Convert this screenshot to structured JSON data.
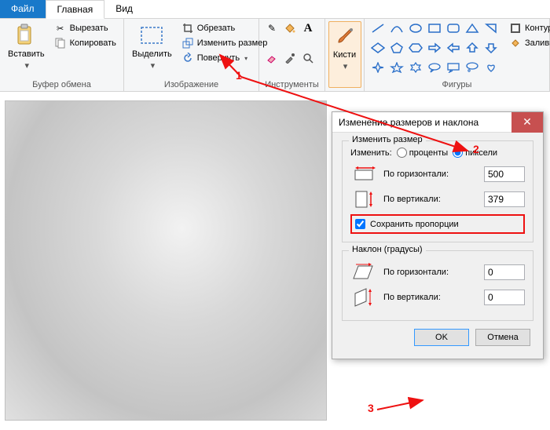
{
  "tabs": {
    "file": "Файл",
    "home": "Главная",
    "view": "Вид"
  },
  "clipboard": {
    "paste": "Вставить",
    "cut": "Вырезать",
    "copy": "Копировать",
    "group": "Буфер обмена"
  },
  "image": {
    "select": "Выделить",
    "crop": "Обрезать",
    "resize": "Изменить размер",
    "rotate": "Повернуть",
    "group": "Изображение"
  },
  "tools": {
    "group": "Инструменты"
  },
  "brushes": {
    "label": "Кисти"
  },
  "shapes": {
    "group": "Фигуры",
    "outline": "Контур",
    "fill": "Заливка"
  },
  "dialog": {
    "title": "Изменение размеров и наклона",
    "resize_legend": "Изменить размер",
    "change_by": "Изменить:",
    "percent": "проценты",
    "pixels": "пиксели",
    "horizontal": "По горизонтали:",
    "vertical": "По вертикали:",
    "h_value": "500",
    "v_value": "379",
    "keep_ratio": "Сохранить пропорции",
    "skew_legend": "Наклон (градусы)",
    "skew_h": "0",
    "skew_v": "0",
    "ok": "OK",
    "cancel": "Отмена"
  },
  "annotations": {
    "a1": "1",
    "a2": "2",
    "a3": "3"
  }
}
